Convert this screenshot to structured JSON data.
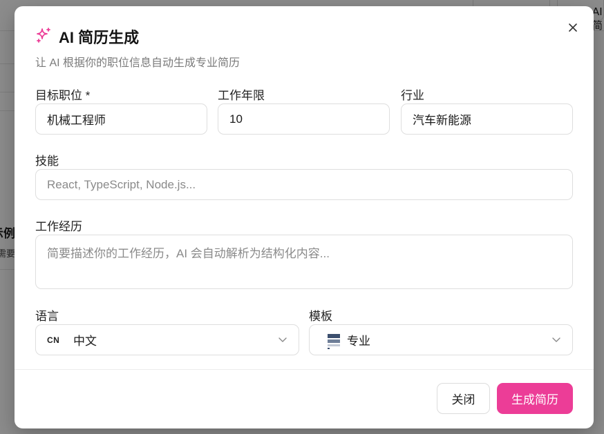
{
  "background": {
    "side_title": "示例",
    "side_subtitle": "需要",
    "top_right_label": "AI 简"
  },
  "dialog": {
    "icon": "sparkles-icon",
    "title": "AI 简历生成",
    "subtitle": "让 AI 根据你的职位信息自动生成专业简历",
    "close_icon": "close-icon",
    "fields": {
      "target_position": {
        "label": "目标职位 *",
        "value": "机械工程师"
      },
      "years": {
        "label": "工作年限",
        "value": "10"
      },
      "industry": {
        "label": "行业",
        "value": "汽车新能源"
      },
      "skills": {
        "label": "技能",
        "value": "",
        "placeholder": "React, TypeScript, Node.js..."
      },
      "experience": {
        "label": "工作经历",
        "value": "",
        "placeholder": "简要描述你的工作经历，AI 会自动解析为结构化内容..."
      },
      "language": {
        "label": "语言",
        "badge": "CN",
        "selected": "中文"
      },
      "template": {
        "label": "模板",
        "icon": "template-thumbnail-icon",
        "selected": "专业"
      }
    },
    "buttons": {
      "close": "关闭",
      "generate": "生成简历"
    },
    "colors": {
      "accent": "#ec3d97"
    }
  }
}
